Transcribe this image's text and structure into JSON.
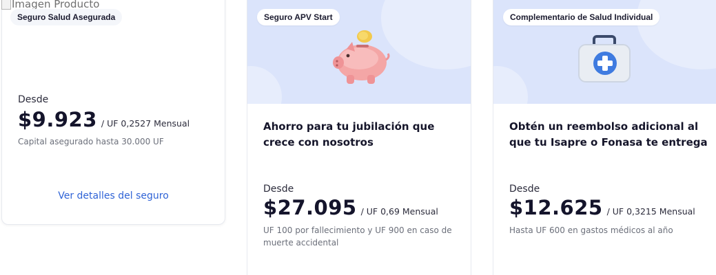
{
  "broken_image_alt": "Imagen Producto",
  "cards": [
    {
      "tag": "Seguro Salud Asegurada",
      "desde_label": "Desde",
      "price": "$9.923",
      "unit": "/ UF 0,2527 Mensual",
      "note": "Capital asegurado hasta 30.000 UF",
      "link": "Ver detalles del seguro"
    },
    {
      "tag": "Seguro APV Start",
      "illustration": "piggy-bank-icon",
      "description": "Ahorro para tu jubilación que crece con nosotros",
      "desde_label": "Desde",
      "price": "$27.095",
      "unit": "/ UF 0,69 Mensual",
      "note": "UF 100 por fallecimiento y UF 900 en caso de muerte accidental"
    },
    {
      "tag": "Complementario de Salud Individual",
      "illustration": "first-aid-kit-icon",
      "description": "Obtén un reembolso adicional al que tu Isapre o Fonasa te entrega",
      "desde_label": "Desde",
      "price": "$12.625",
      "unit": "/ UF 0,3215 Mensual",
      "note": "Hasta UF 600 en gastos médicos al año"
    }
  ],
  "colors": {
    "hero_background": "#dbe4fb",
    "link": "#2f63d6",
    "price_text": "#14142b",
    "note_text": "#6b6f7a"
  }
}
